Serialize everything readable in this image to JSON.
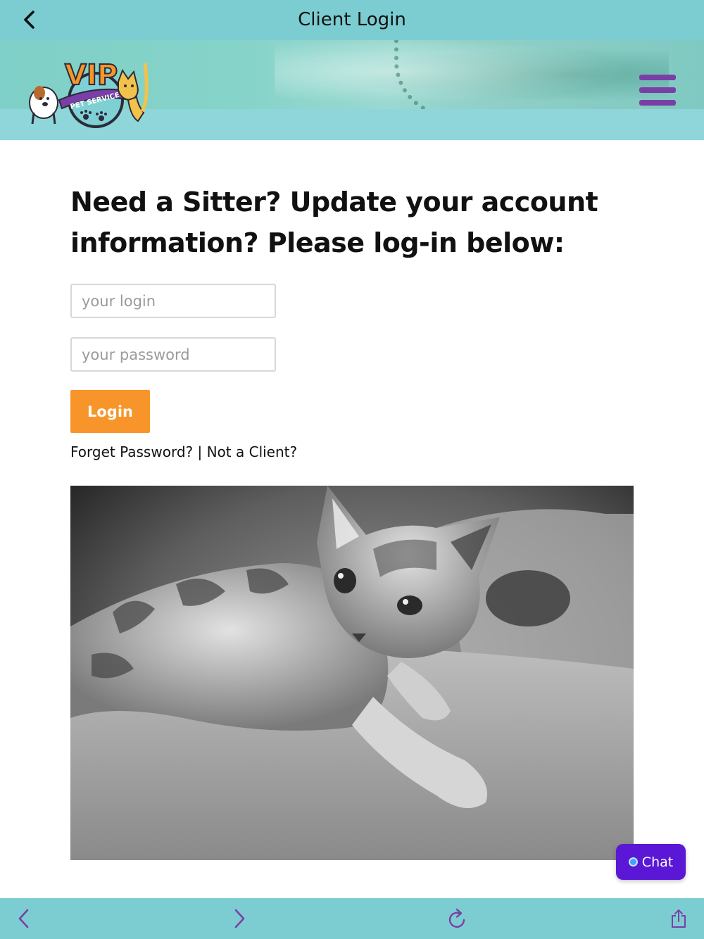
{
  "app_bar": {
    "title": "Client Login",
    "back_icon": "chevron-left-icon",
    "bg_color": "#7ccdd2"
  },
  "header": {
    "logo": {
      "text_main": "VIP",
      "text_sub": "PET SERVICES"
    },
    "menu_icon": "hamburger-menu-icon",
    "menu_color": "#7a3fa6"
  },
  "main": {
    "heading": "Need a Sitter? Update your account information? Please log-in below:",
    "login_field": {
      "placeholder": "your login",
      "value": ""
    },
    "password_field": {
      "placeholder": "your password",
      "value": ""
    },
    "login_button": {
      "label": "Login",
      "color": "#f7952a"
    },
    "forgot_password_link": "Forget Password?",
    "separator": " | ",
    "not_client_link": "Not a Client?"
  },
  "chat_button": {
    "label": "Chat",
    "color": "#5a18d6"
  },
  "bottom_toolbar": {
    "back_icon": "chevron-left-icon",
    "forward_icon": "chevron-right-icon",
    "reload_icon": "reload-icon",
    "share_icon": "share-icon",
    "icon_color": "#7a3fa6"
  }
}
